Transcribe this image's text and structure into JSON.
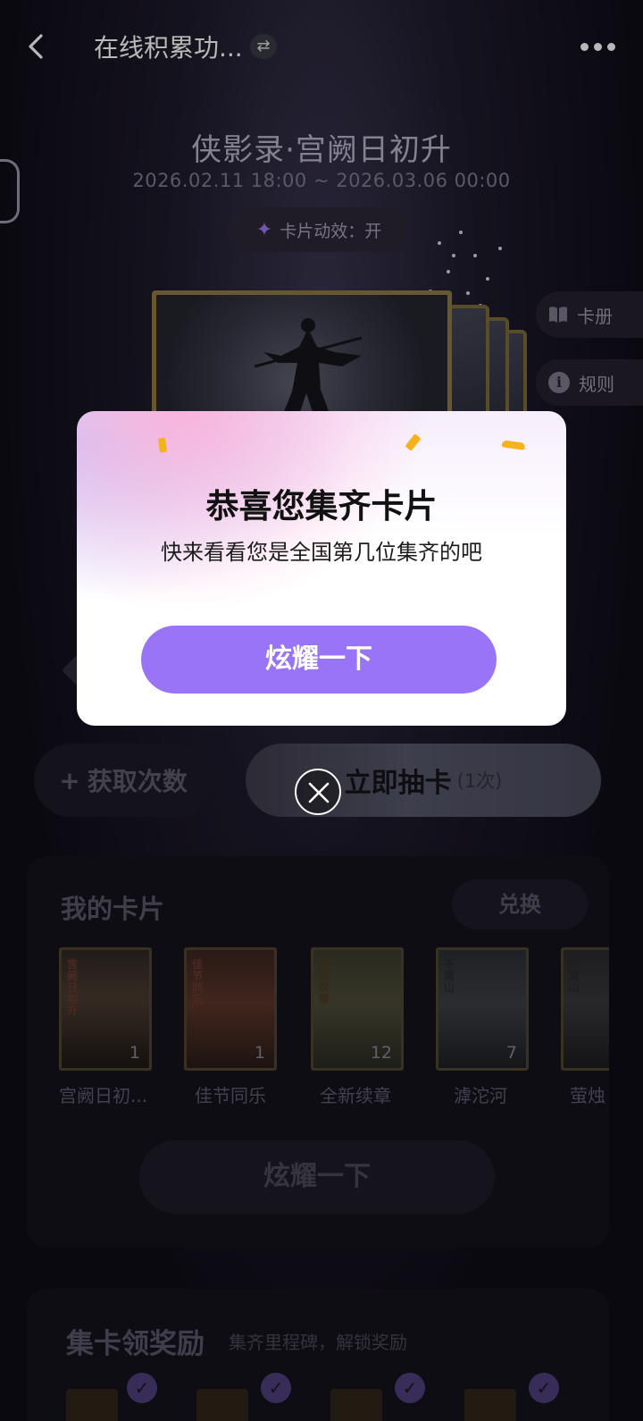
{
  "nav": {
    "title": "在线积累功...",
    "switch_icon": "⇄"
  },
  "event": {
    "title": "侠影录·宫阙日初升",
    "period": "2026.02.11 18:00 ~ 2026.03.06 00:00",
    "effect_toggle": "卡片动效：开"
  },
  "side": {
    "album_label": "卡册",
    "rules_label": "规则"
  },
  "actions": {
    "get_count_plus": "+",
    "get_count_label": "获取次数",
    "draw_label": "立即抽卡",
    "draw_count": "(1次)"
  },
  "my_cards": {
    "title": "我的卡片",
    "redeem_label": "兑换",
    "items": [
      {
        "name": "宫阙日初...",
        "count": "1",
        "vtext": "宫阙日初升"
      },
      {
        "name": "佳节同乐",
        "count": "1",
        "vtext": "佳节同乐"
      },
      {
        "name": "全新续章",
        "count": "12",
        "vtext": "全新续章"
      },
      {
        "name": "滹沱河",
        "count": "7",
        "vtext": "不周山"
      },
      {
        "name": "萤烛",
        "count": "",
        "vtext": "不周山"
      }
    ],
    "show_off_label": "炫耀一下"
  },
  "rewards": {
    "title": "集卡领奖励",
    "subtitle": "集齐里程碑，解锁奖励"
  },
  "dialog": {
    "title": "恭喜您集齐卡片",
    "subtitle": "快来看看您是全国第几位集齐的吧",
    "button_label": "炫耀一下"
  },
  "colors": {
    "accent": "#9a74f6",
    "confetti": "#f5b21c",
    "background": "#0f0d17"
  }
}
